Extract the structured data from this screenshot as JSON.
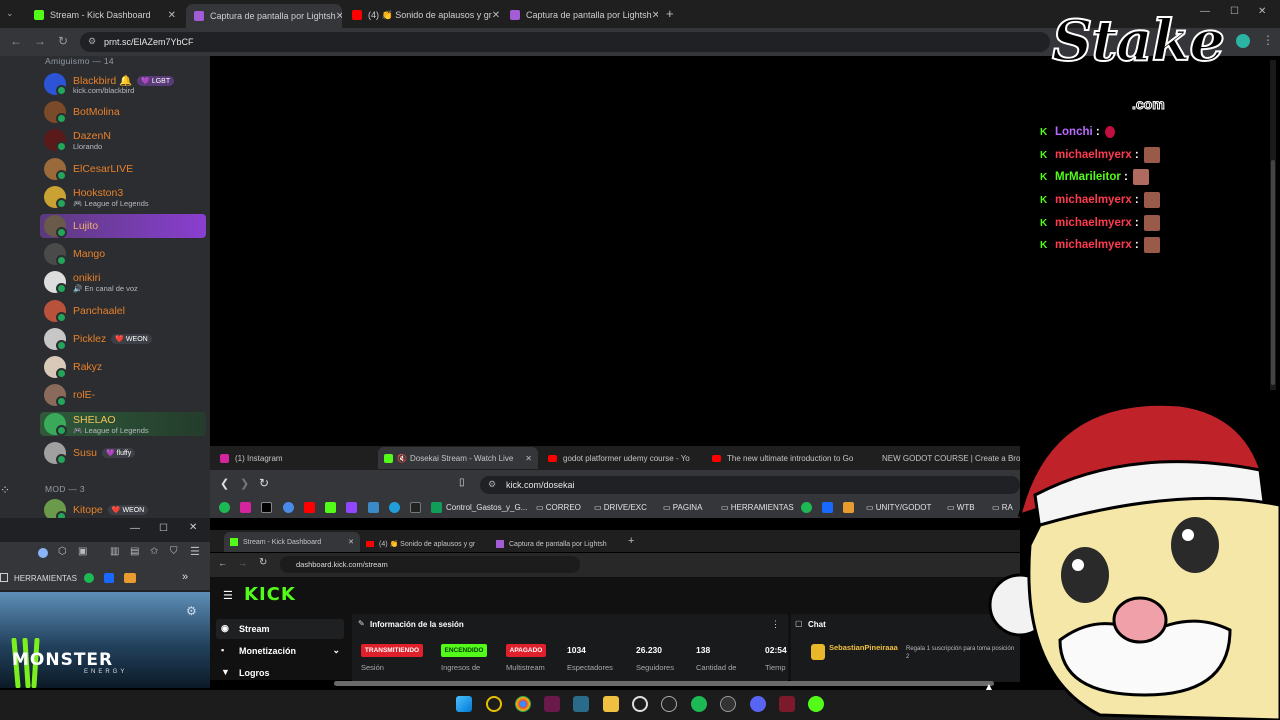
{
  "browser": {
    "tabs": [
      {
        "title": "Stream - Kick Dashboard",
        "color": "#53fc18"
      },
      {
        "title": "Captura de pantalla por Lightsh",
        "color": "#a45bd6"
      },
      {
        "title": "(4) 👏 Sonido de aplausos y gr",
        "color": "#ff0000"
      },
      {
        "title": "Captura de pantalla por Lightsh",
        "color": "#a45bd6"
      }
    ],
    "url": "prnt.sc/ElAZem7YbCF"
  },
  "sidebar": {
    "section_friends": "Amiguismo — 14",
    "section_mod": "MOD — 3",
    "friends": [
      {
        "name": "Blackbird 🔔",
        "sub": "kick.com/blackbird",
        "badge": "💜 LGBT"
      },
      {
        "name": "BotMolina",
        "sub": "",
        "badge": ""
      },
      {
        "name": "DazenN",
        "sub": "Llorando",
        "badge": ""
      },
      {
        "name": "ElCesarLIVE",
        "sub": "",
        "badge": ""
      },
      {
        "name": "Hookston3",
        "sub": "🎮 League of Legends",
        "badge": ""
      },
      {
        "name": "Lujito",
        "sub": "",
        "badge": ""
      },
      {
        "name": "Mango",
        "sub": "",
        "badge": ""
      },
      {
        "name": "onikiri",
        "sub": "🔊 En canal de voz",
        "badge": ""
      },
      {
        "name": "Panchaalel",
        "sub": "",
        "badge": ""
      },
      {
        "name": "Picklez",
        "sub": "",
        "badge": "❤️ WEON"
      },
      {
        "name": "Rakyz",
        "sub": "",
        "badge": ""
      },
      {
        "name": "rolE-",
        "sub": "",
        "badge": ""
      },
      {
        "name": "SHELAO",
        "sub": "🎮 League of Legends",
        "badge": ""
      },
      {
        "name": "Susu",
        "sub": "",
        "badge": "💜 fluffy"
      }
    ],
    "mod_first": {
      "name": "Kitope",
      "badge": "❤️ WEON"
    }
  },
  "left_window": {
    "bookmark": "HERRAMIENTAS",
    "brand": "MONSTER",
    "brand_sub": "ENERGY"
  },
  "overlay": {
    "logo": "Stake",
    "logo_sub": ".com",
    "chat": [
      {
        "user": "Lonchi",
        "color": "#b86bff"
      },
      {
        "user": "michaelmyerx",
        "color": "#ff3b4e"
      },
      {
        "user": "MrMarileitor",
        "color": "#53fc18"
      },
      {
        "user": "michaelmyerx",
        "color": "#ff3b4e"
      },
      {
        "user": "michaelmyerx",
        "color": "#ff3b4e"
      },
      {
        "user": "michaelmyerx",
        "color": "#ff3b4e"
      }
    ]
  },
  "mid_browser": {
    "tabs": [
      "(1) Instagram",
      "Dosekai Stream - Watch Live",
      "godot platformer udemy course - Yo",
      "The new ultimate introduction to Go",
      "NEW GODOT COURSE | Create a Bro"
    ],
    "url": "kick.com/dosekai",
    "bookmarks": [
      "Control_Gastos_y_G...",
      "CORREO",
      "DRIVE/EXC",
      "PAGINA",
      "HERRAMIENTAS",
      "UNITY/GODOT",
      "WTB",
      "RA"
    ]
  },
  "inner_browser": {
    "tabs": [
      "Stream - Kick Dashboard",
      "(4) 👏 Sonido de aplausos y gr",
      "Captura de pantalla por Lightsh"
    ],
    "url": "dashboard.kick.com/stream",
    "logo": "KICK",
    "nav": [
      "Stream",
      "Monetización",
      "Logros"
    ],
    "panel_title": "Información de la sesión",
    "status": [
      "TRANSMITIENDO",
      "ENCENDIDO",
      "APAGADO"
    ],
    "stats": [
      {
        "value": "1034",
        "label": "Espectadores"
      },
      {
        "value": "26.230",
        "label": "Seguidores"
      },
      {
        "value": "138",
        "label": "Cantidad de"
      },
      {
        "value": "02:54",
        "label": "Tiemp"
      }
    ],
    "status_labels": [
      "Sesión",
      "Ingresos de",
      "Multistream"
    ],
    "chat_title": "Chat",
    "chat_user": "SebastianPineiraaa",
    "chat_msg": "Regala 1 suscripción para toma posición 2"
  }
}
